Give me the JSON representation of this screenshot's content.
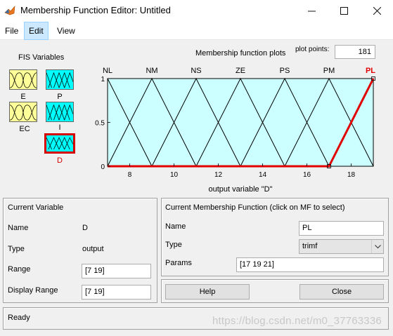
{
  "window": {
    "title": "Membership Function Editor: Untitled",
    "min_glyph": "—",
    "max_glyph": "☐",
    "close_glyph": "✕"
  },
  "menu": {
    "items": [
      "File",
      "Edit",
      "View"
    ],
    "active": "Edit"
  },
  "fis": {
    "heading": "FIS Variables",
    "inputs": [
      {
        "name": "E",
        "color": "#ffff99"
      },
      {
        "name": "EC",
        "color": "#ffff99"
      }
    ],
    "outputs": [
      {
        "name": "P",
        "color": "#00ffff"
      },
      {
        "name": "I",
        "color": "#00ffff"
      },
      {
        "name": "D",
        "color": "#00ffff",
        "selected": true,
        "label_color": "#d40000"
      }
    ]
  },
  "plot": {
    "title": "Membership function plots",
    "plot_points_label": "plot points:",
    "plot_points_value": "181",
    "xlabel": "output variable \"D\"",
    "background": "#ccffff",
    "selected_color": "#e00000"
  },
  "chart_data": {
    "type": "line",
    "xlim": [
      7,
      19
    ],
    "ylim": [
      0,
      1
    ],
    "x_ticks": [
      "8",
      "10",
      "12",
      "14",
      "16",
      "18"
    ],
    "x_tick_values": [
      8,
      10,
      12,
      14,
      16,
      18
    ],
    "y_ticks": [
      "0",
      "0.5",
      "1"
    ],
    "y_tick_values": [
      0,
      0.5,
      1
    ],
    "series": [
      {
        "name": "NL",
        "params": [
          5,
          7,
          9
        ]
      },
      {
        "name": "NM",
        "params": [
          7,
          9,
          11
        ]
      },
      {
        "name": "NS",
        "params": [
          9,
          11,
          13
        ]
      },
      {
        "name": "ZE",
        "params": [
          11,
          13,
          15
        ]
      },
      {
        "name": "PS",
        "params": [
          13,
          15,
          17
        ]
      },
      {
        "name": "PM",
        "params": [
          15,
          17,
          19
        ]
      },
      {
        "name": "PL",
        "params": [
          17,
          19,
          21
        ],
        "selected": true
      }
    ]
  },
  "current_variable": {
    "heading": "Current Variable",
    "name_label": "Name",
    "name_value": "D",
    "type_label": "Type",
    "type_value": "output",
    "range_label": "Range",
    "range_value": "[7 19]",
    "display_range_label": "Display Range",
    "display_range_value": "[7 19]"
  },
  "current_mf": {
    "heading": "Current Membership Function (click on MF to select)",
    "name_label": "Name",
    "name_value": "PL",
    "type_label": "Type",
    "type_value": "trimf",
    "params_label": "Params",
    "params_value": "[17 19 21]"
  },
  "buttons": {
    "help": "Help",
    "close": "Close"
  },
  "status": {
    "text": "Ready"
  },
  "watermark": "https://blog.csdn.net/m0_37763336"
}
